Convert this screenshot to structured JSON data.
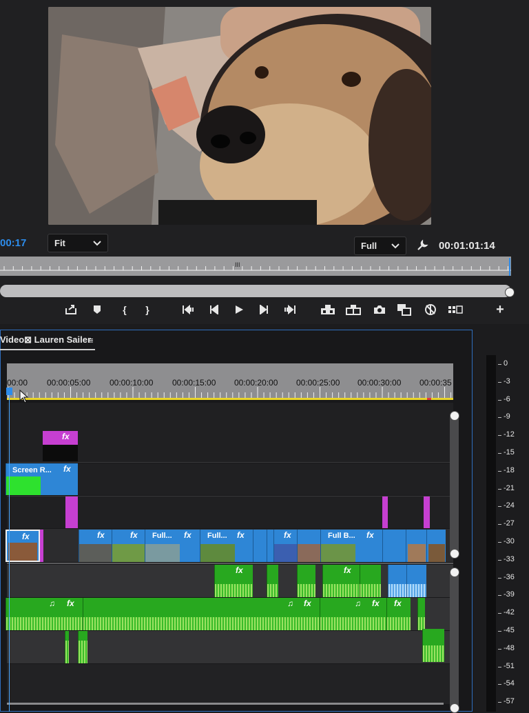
{
  "program_monitor": {
    "timecode_left": "00:17",
    "zoom_dropdown": "Fit",
    "resolution_dropdown": "Full",
    "timecode_right": "00:01:01:14"
  },
  "transport_icons": [
    "export-frame-icon",
    "marker-icon",
    "mark-in-icon",
    "mark-out-icon",
    "go-to-in-icon",
    "step-back-icon",
    "play-icon",
    "step-forward-icon",
    "go-to-out-icon",
    "lift-icon",
    "extract-icon",
    "camera-icon",
    "comparison-icon",
    "proxy-toggle-icon",
    "multicam-icon",
    "add-button-icon"
  ],
  "timeline": {
    "sequence_tab": "Video⊠ Lauren Sailer",
    "menu_glyph": "≡",
    "ruler_labels": [
      "00:00",
      "00:00:05:00",
      "00:00:10:00",
      "00:00:15:00",
      "00:00:20:00",
      "00:00:25:00",
      "00:00:30:00",
      "00:00:35"
    ]
  },
  "clips": {
    "fx": "fx",
    "screen_r": "Screen R...",
    "full1": "Full...",
    "full2": "Full...",
    "full_b": "Full B...",
    "note": "♫"
  },
  "audio_meter": {
    "scale": [
      "0",
      "-3",
      "-6",
      "-9",
      "-12",
      "-15",
      "-18",
      "-21",
      "-24",
      "-27",
      "-30",
      "-33",
      "-36",
      "-39",
      "-42",
      "-45",
      "-48",
      "-51",
      "-54",
      "-57"
    ]
  },
  "colors": {
    "accent": "#2d8ceb",
    "video_clip": "#2e86d6",
    "audio_clip": "#28a81f",
    "adjustment_clip": "#c63fd1",
    "work_area": "#e9d52a"
  }
}
